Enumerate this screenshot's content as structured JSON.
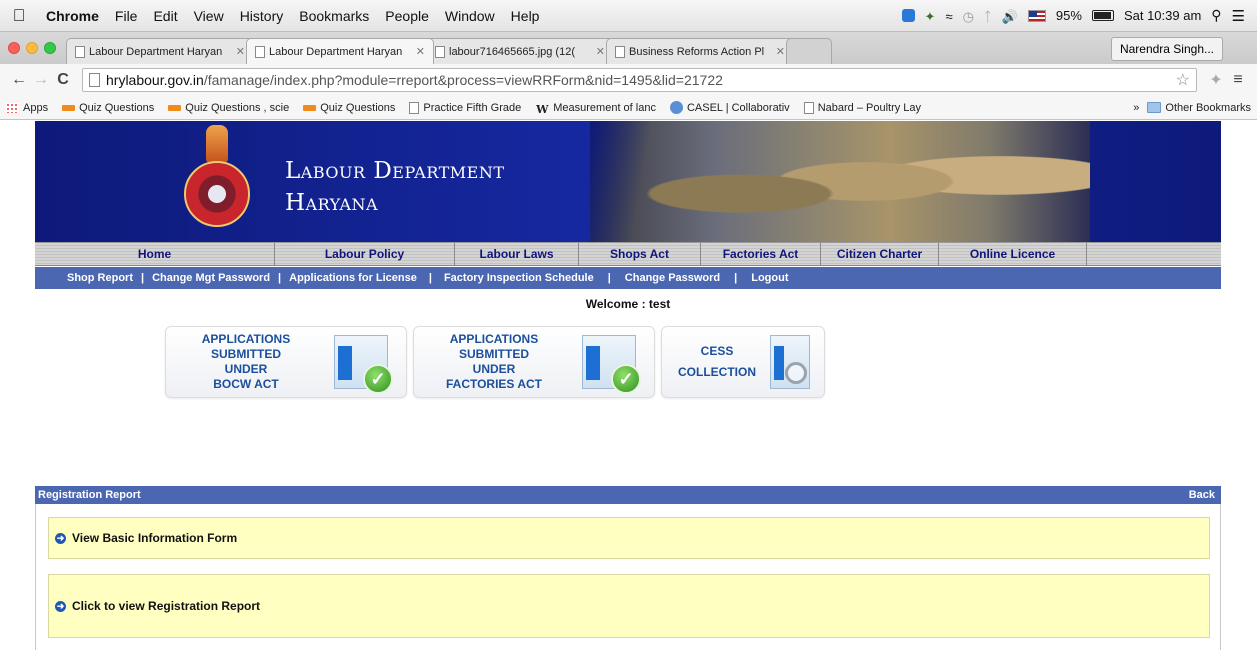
{
  "menubar": {
    "app_name": "Chrome",
    "items": [
      "File",
      "Edit",
      "View",
      "History",
      "Bookmarks",
      "People",
      "Window",
      "Help"
    ],
    "battery": "95%",
    "clock": "Sat 10:39 am"
  },
  "tabs": [
    {
      "title": "Labour Department Haryan",
      "active": false
    },
    {
      "title": "Labour Department Haryan",
      "active": true
    },
    {
      "title": "labour716465665.jpg (12(",
      "active": false
    },
    {
      "title": "Business Reforms Action Pl",
      "active": false
    }
  ],
  "profile_name": "Narendra Singh...",
  "omnibox": {
    "host": "hrylabour.gov.in",
    "path": "/famanage/index.php?module=rreport&process=viewRRForm&nid=1495&lid=21722"
  },
  "bookmarks": {
    "items": [
      {
        "label": "Apps",
        "icon": "apps-grid-icon"
      },
      {
        "label": "Quiz Questions",
        "icon": "quiz-bookmark-icon"
      },
      {
        "label": "Quiz Questions , scie",
        "icon": "quiz-bookmark-icon"
      },
      {
        "label": "Quiz Questions",
        "icon": "quiz-bookmark-icon"
      },
      {
        "label": "Practice Fifth Grade",
        "icon": "page-icon"
      },
      {
        "label": "Measurement of lanc",
        "icon": "wikipedia-icon"
      },
      {
        "label": "CASEL | Collaborativ",
        "icon": "casel-icon"
      },
      {
        "label": "Nabard – Poultry Lay",
        "icon": "page-icon"
      }
    ],
    "overflow": "»",
    "other": "Other Bookmarks"
  },
  "site": {
    "title_line1": "Labour Department",
    "title_line2": "Haryana",
    "nav": [
      "Home",
      "Labour Policy",
      "Labour Laws",
      "Shops Act",
      "Factories Act",
      "Citizen Charter",
      "Online Licence"
    ],
    "subnav": [
      "Shop Report",
      "Change Mgt Password",
      "Applications for License",
      "Factory Inspection Schedule",
      "Change Password",
      "Logout"
    ],
    "welcome": "Welcome : test",
    "tiles": [
      {
        "line1": "Applications Submitted",
        "line2": "Under",
        "line3": "BOCW Act"
      },
      {
        "line1": "Applications Submitted",
        "line2": "Under",
        "line3": "Factories Act"
      },
      {
        "line1": "CESS",
        "line2": "Collection"
      }
    ],
    "report_title": "Registration Report",
    "back_label": "Back",
    "panels": [
      "View Basic Information Form",
      "Click to view Registration Report"
    ]
  },
  "colors": {
    "header_blue": "#0d1a7a",
    "subnav_blue": "#4b67b2",
    "panel_yellow": "#ffffc2",
    "tile_text": "#1b4f9c"
  }
}
